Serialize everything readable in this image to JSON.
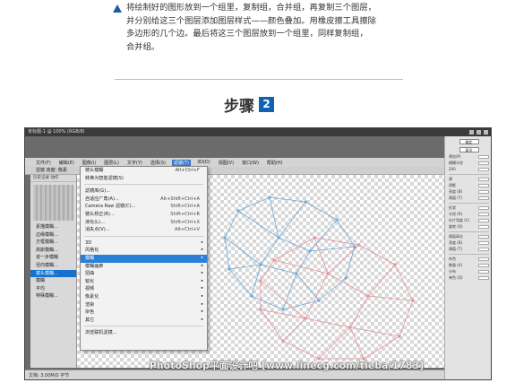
{
  "instruction": {
    "lines": [
      "将绘制好的图形放到一个组里，复制组，合并组，再复制三个图层，",
      "并分别给这三个图层添加图层样式——颜色叠加。用橡皮擦工具擦除",
      "多边形的几个边。最后将这三个图层放到一个组里，同样复制组，",
      "合并组。"
    ]
  },
  "step": {
    "label": "步骤",
    "number": "2"
  },
  "app": {
    "title": "未标题-1 @ 100% (RGB/8)",
    "menubar": [
      "文件(F)",
      "编辑(E)",
      "图像(I)",
      "图层(L)",
      "文字(Y)",
      "选择(S)",
      "滤镜(T)",
      "3D(D)",
      "视图(V)",
      "窗口(W)",
      "帮助(H)"
    ],
    "active_menu_index": 6,
    "options_bar": "滤镜   高度: 像素",
    "left_panel": {
      "tabs": [
        "历史记录",
        "动作"
      ],
      "items": [
        "素描模糊...",
        "边缘模糊...",
        "方框模糊...",
        "高斯模糊...",
        "进一步模糊",
        "径向模糊...",
        "镜头模糊...",
        "模糊",
        "平均",
        "特殊模糊..."
      ],
      "active_index": 6
    },
    "status": "文档: 3.00M/0 字节"
  },
  "filter_menu": {
    "items": [
      {
        "label": "镜头模糊",
        "shortcut": "Alt+Ctrl+F"
      },
      {
        "label": "转换为智能滤镜(S)",
        "shortcut": ""
      },
      {
        "label": "滤镜库(G)...",
        "shortcut": ""
      },
      {
        "label": "自适应广角(A)...",
        "shortcut": "Alt+Shift+Ctrl+A"
      },
      {
        "label": "Camera Raw 滤镜(C)...",
        "shortcut": "Shift+Ctrl+A"
      },
      {
        "label": "镜头校正(R)...",
        "shortcut": "Shift+Ctrl+R"
      },
      {
        "label": "液化(L)...",
        "shortcut": "Shift+Ctrl+X"
      },
      {
        "label": "消失点(V)...",
        "shortcut": "Alt+Ctrl+V"
      },
      {
        "label": "3D",
        "shortcut": ""
      },
      {
        "label": "风格化",
        "shortcut": ""
      },
      {
        "label": "模糊",
        "shortcut": ""
      },
      {
        "label": "模糊画廊",
        "shortcut": ""
      },
      {
        "label": "扭曲",
        "shortcut": ""
      },
      {
        "label": "锐化",
        "shortcut": ""
      },
      {
        "label": "视频",
        "shortcut": ""
      },
      {
        "label": "像素化",
        "shortcut": ""
      },
      {
        "label": "渲染",
        "shortcut": ""
      },
      {
        "label": "杂色",
        "shortcut": ""
      },
      {
        "label": "其它",
        "shortcut": ""
      },
      {
        "label": "浏览联机滤镜...",
        "shortcut": ""
      }
    ],
    "highlight_index": 10
  },
  "right_panel": {
    "buttons": [
      "确定",
      "复位"
    ],
    "rows": [
      "预览(P)",
      "模糊半径",
      "200",
      "源",
      "阴影",
      "亮度 (B)",
      "阈值 (T)",
      "形状",
      "半径 (R)",
      "叶片弯度 (C)",
      "旋转 (O)",
      "镜面高光",
      "亮度 (B)",
      "阈值 (T)",
      "杂色",
      "数量 (A)",
      "分布",
      "单色 (O)"
    ]
  },
  "colors": {
    "blue_lines": "#6aaad8",
    "pink_lines": "#e8919b",
    "accent": "#2a7fd8",
    "step_badge": "#0f63b3"
  },
  "watermark": "PhotoShop平面设计吧 [www.linecg.com/tieba/1783]"
}
